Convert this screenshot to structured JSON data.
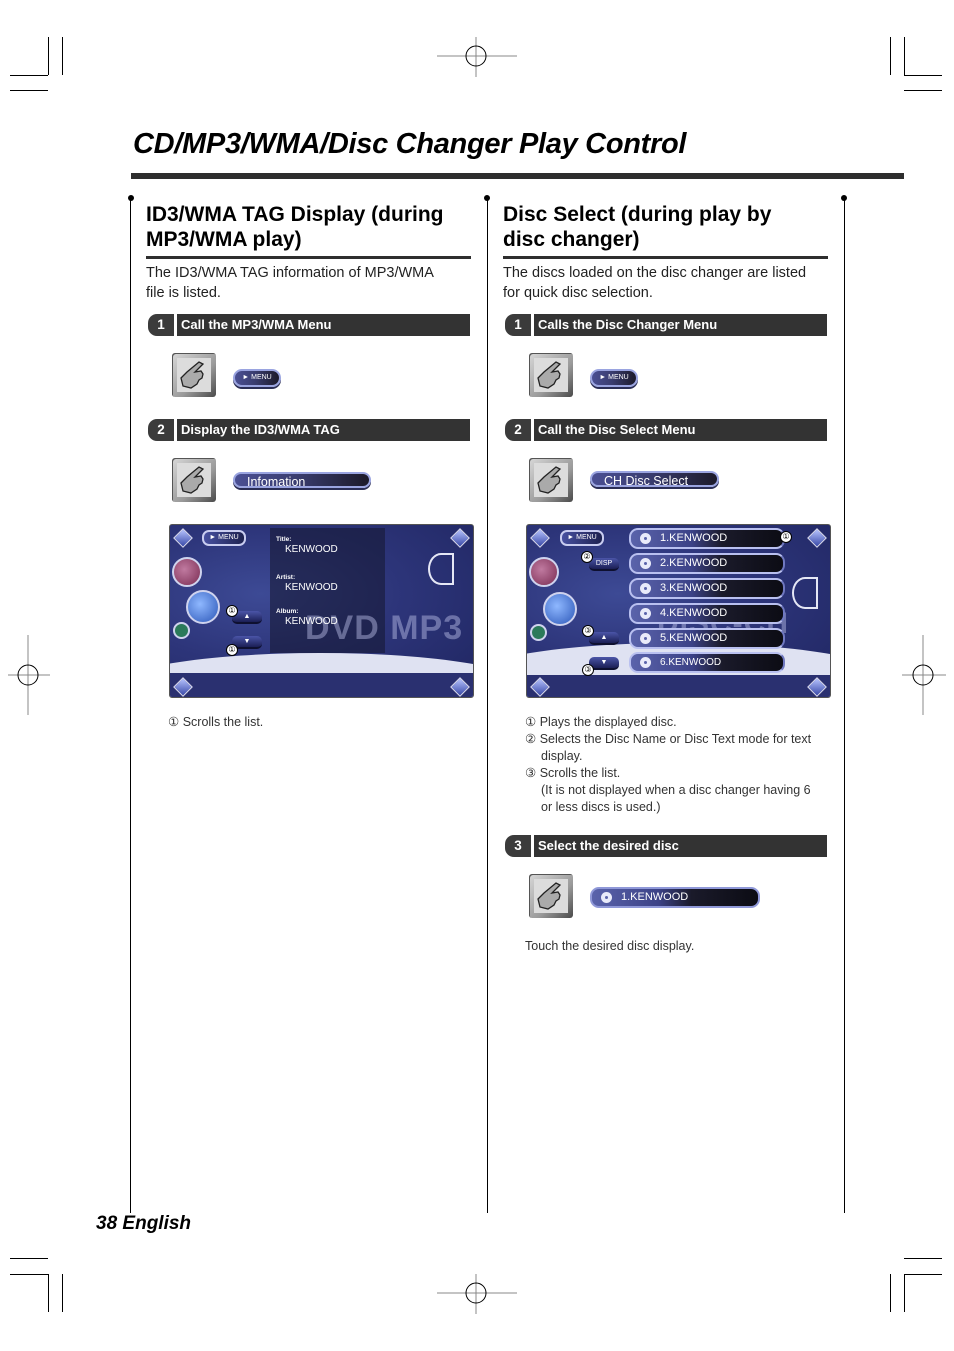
{
  "page": {
    "title": "CD/MP3/WMA/Disc Changer Play Control",
    "footer": "38 English"
  },
  "left": {
    "heading": "ID3/WMA TAG Display (during MP3/WMA play)",
    "heading_line1": "ID3/WMA TAG Display (during",
    "heading_line2": "MP3/WMA play)",
    "intro_line1": "The ID3/WMA TAG information of MP3/WMA",
    "intro_line2": "file is listed.",
    "steps": [
      {
        "num": "1",
        "label": "Call the MP3/WMA Menu",
        "button": "MENU",
        "button_icon": "play-triangle-icon"
      },
      {
        "num": "2",
        "label": "Display the ID3/WMA TAG",
        "button": "Infomation"
      }
    ],
    "screen": {
      "menu_button": "MENU",
      "fields": [
        {
          "label": "Title:",
          "value": "KENWOOD"
        },
        {
          "label": "Artist:",
          "value": "KENWOOD"
        },
        {
          "label": "Album:",
          "value": "KENWOOD"
        }
      ],
      "watermark": "DVD MP3",
      "scroll_up": "▲",
      "scroll_down": "▼",
      "callouts": [
        "①",
        "①"
      ]
    },
    "notes": [
      {
        "marker": "①",
        "text": "Scrolls the list."
      }
    ]
  },
  "right": {
    "heading_line1": "Disc Select (during play by",
    "heading_line2": "disc changer)",
    "intro_line1": "The discs loaded on the disc changer are listed",
    "intro_line2": "for quick disc selection.",
    "steps": [
      {
        "num": "1",
        "label": "Calls the Disc Changer Menu",
        "button": "MENU"
      },
      {
        "num": "2",
        "label": "Call the Disc Select Menu",
        "button": "CH Disc Select"
      },
      {
        "num": "3",
        "label": "Select the desired disc",
        "button": "1.KENWOOD"
      }
    ],
    "screen": {
      "menu_button": "MENU",
      "disp_button": "DISP",
      "discs": [
        "1.KENWOOD",
        "2.KENWOOD",
        "3.KENWOOD",
        "4.KENWOOD",
        "5.KENWOOD",
        "6.KENWOOD"
      ],
      "scroll_up": "▲",
      "scroll_down": "▼",
      "watermark": "DISC-CH",
      "callouts": [
        "①",
        "②",
        "③",
        "③"
      ]
    },
    "notes": [
      {
        "marker": "①",
        "text": "Plays the displayed disc."
      },
      {
        "marker": "②",
        "text": "Selects the Disc Name or Disc Text mode for text",
        "cont": "display."
      },
      {
        "marker": "③",
        "text": "Scrolls the list.",
        "cont": "(It is not displayed when a disc changer having 6",
        "cont2": "or less discs is used.)"
      }
    ],
    "step3_note": "Touch the desired disc display."
  },
  "colors": {
    "step_bar": "#333333",
    "screen_blue": "#2d357a",
    "pill_border": "#9aa4e0"
  }
}
